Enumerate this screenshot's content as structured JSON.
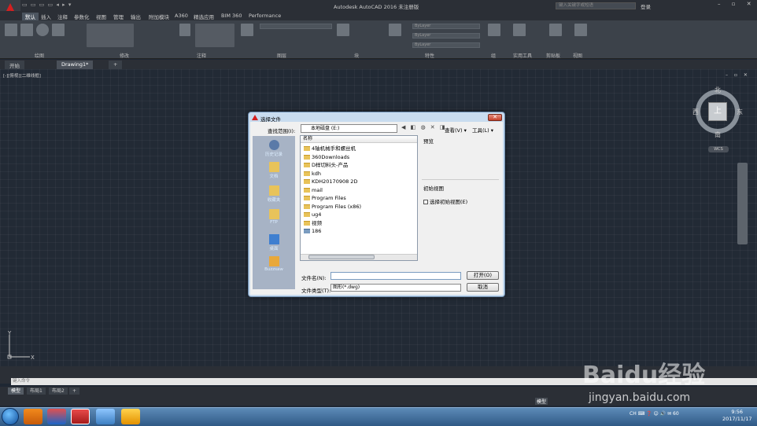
{
  "app": {
    "title": "Autodesk AutoCAD 2016    未注册版",
    "search_placeholder": "键入关键字或短语",
    "login": "登录",
    "window_controls": "– ▫ ✕"
  },
  "ribbon_tabs": [
    "默认",
    "插入",
    "注释",
    "参数化",
    "视图",
    "管理",
    "输出",
    "附加模块",
    "A360",
    "精选应用",
    "BIM 360",
    "Performance"
  ],
  "ribbon_panels": [
    "绘图",
    "修改",
    "注释",
    "图层",
    "块",
    "特性",
    "组",
    "实用工具",
    "剪贴板",
    "视图"
  ],
  "layer_dropdowns": [
    "ByLayer",
    "ByLayer",
    "ByLayer"
  ],
  "file_tabs": [
    {
      "label": "开始"
    },
    {
      "label": "Drawing1*"
    },
    {
      "label": "+"
    }
  ],
  "viewport": {
    "label": "[-][俯视][二维线框]",
    "controls": "– ▫ ✕",
    "viewcube_face": "上",
    "north": "北",
    "south": "南",
    "east": "东",
    "west": "西",
    "wcs": "WCS"
  },
  "ucs": {
    "x": "X",
    "y": "Y"
  },
  "command": {
    "placeholder": "键入命令"
  },
  "layout_tabs": [
    "模型",
    "布局1",
    "布局2",
    "+"
  ],
  "status": {
    "model": "模型"
  },
  "taskbar": {
    "time": "9:56",
    "date": "2017/11/17",
    "tray": "CH ⌨ ❓ ☺ 🔊 ✉ 60"
  },
  "watermark": {
    "brand": "Baidu经验",
    "url": "jingyan.baidu.com"
  },
  "dialog": {
    "title": "选择文件",
    "close": "✕",
    "lookin_label": "查找范围(I):",
    "lookin_value": "本地磁盘 (E:)",
    "view_menu": "查看(V) ▾",
    "tools_menu": "工具(L) ▾",
    "places": [
      "历史记录",
      "文档",
      "收藏夹",
      "FTP",
      "桌面",
      "Buzzsaw"
    ],
    "list_header": "名称",
    "files": [
      "4轴机械手和螺丝机",
      "360Downloads",
      "D样切料头-产品",
      "kdh",
      "KDH20170908 2D",
      "mail",
      "Program Files",
      "Program Files (x86)",
      "ug4",
      "视频",
      "186"
    ],
    "preview_label": "预览",
    "initview_label": "初始视图",
    "initview_check": "选择初始视图(E)",
    "filename_label": "文件名(N):",
    "filename_value": "",
    "filetype_label": "文件类型(T):",
    "filetype_value": "图形(*.dwg)",
    "open_button": "打开(O)",
    "cancel_button": "取消"
  },
  "colors": {
    "accent": "#d42020",
    "dialog_border": "#6b8cb0",
    "taskbar": "#2f5985"
  }
}
